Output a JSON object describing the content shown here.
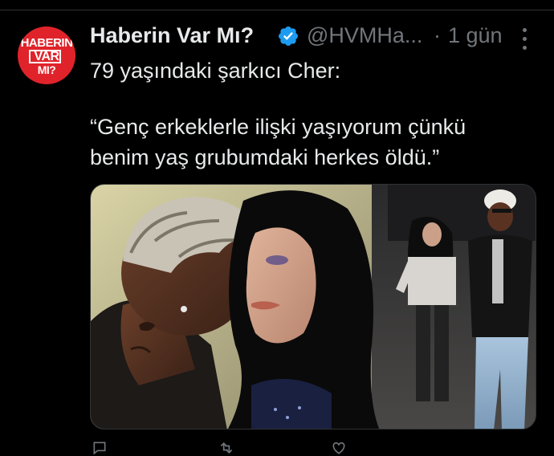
{
  "avatar": {
    "line1": "HABERIN",
    "line2": "VAR",
    "line3": "MI?"
  },
  "tweet": {
    "display_name": "Haberin Var Mı?",
    "handle": "@HVMHa...",
    "separator": "·",
    "time": "1 gün",
    "text_line1": "79 yaşındaki şarkıcı Cher:",
    "text_line2": "“Genç erkeklerle ilişki yaşıyorum çünkü",
    "text_line3": "benim yaş grubumdaki herkes öldü.”"
  },
  "icons": {
    "verified": "verified-badge-icon",
    "more": "more-options-icon"
  },
  "colors": {
    "background": "#000000",
    "text": "#e7e9ea",
    "secondary": "#71767b",
    "verified": "#1d9bf0",
    "avatar_red": "#e0232a"
  }
}
